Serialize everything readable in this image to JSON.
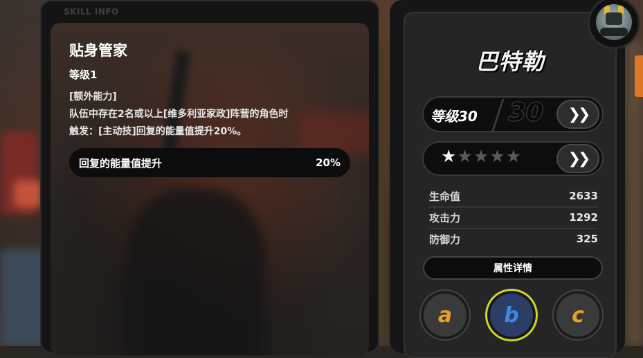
{
  "skill_panel": {
    "tag": "SKILL INFO",
    "skill_name": "贴身管家",
    "skill_level": "等级1",
    "desc_line1": "[额外能力]",
    "desc_line2": "队伍中存在2名或以上[维多利亚家政]阵营的角色时",
    "desc_line3": "触发：[主动技]回复的能量值提升20%。",
    "effect_label": "回复的能量值提升",
    "effect_value": "20%"
  },
  "agent": {
    "name": "巴特勒",
    "avatar_icon": "robot-agent-avatar-icon",
    "level_label": "等级30",
    "level_max": "30",
    "stars_filled": 1,
    "stars_total": 5,
    "star_icon": "star-icon",
    "arrow_icon": "double-chevron-right-icon",
    "arrow_glyph": "❯❯"
  },
  "stats": [
    {
      "label": "生命值",
      "value": "2633"
    },
    {
      "label": "攻击力",
      "value": "1292"
    },
    {
      "label": "防御力",
      "value": "325"
    }
  ],
  "attr_detail_label": "属性详情",
  "skill_buttons": [
    {
      "letter": "a",
      "color": "#e6a02a",
      "selected": false
    },
    {
      "letter": "b",
      "color": "#3b8ae0",
      "selected": true
    },
    {
      "letter": "c",
      "color": "#e6a02a",
      "selected": false
    }
  ],
  "colors": {
    "accent_orange": "#e0782a",
    "selected_ring": "#c9d82a"
  }
}
